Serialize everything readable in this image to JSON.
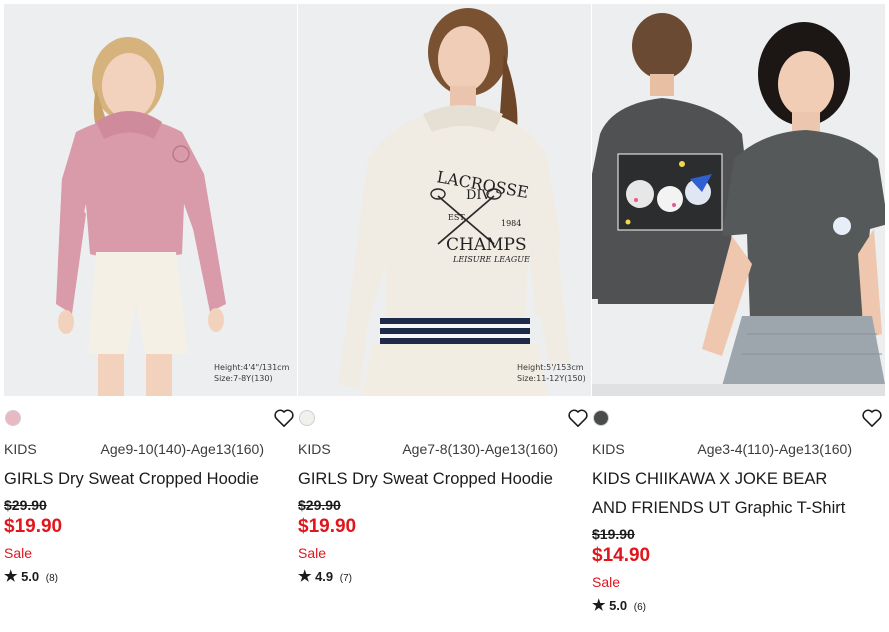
{
  "products": [
    {
      "swatch_color": "#eab8c3",
      "tag": "KIDS",
      "ages": "Age9-10(140)-Age13(160)",
      "title": "GIRLS Dry Sweat Cropped Hoodie",
      "old_price": "$29.90",
      "new_price": "$19.90",
      "sale": "Sale",
      "rating": "5.0",
      "review_count": "(8)",
      "height_note": "Height:4'4\"/131cm",
      "size_note": "Size:7-8Y(130)"
    },
    {
      "swatch_color": "#f2f0ec",
      "tag": "KIDS",
      "ages": "Age7-8(130)-Age13(160)",
      "title": "GIRLS Dry Sweat Cropped Hoodie",
      "old_price": "$29.90",
      "new_price": "$19.90",
      "sale": "Sale",
      "rating": "4.9",
      "review_count": "(7)",
      "height_note": "Height:5'/153cm",
      "size_note": "Size:11-12Y(150)",
      "print": {
        "line1": "LACROSSE",
        "line2": "DIV.",
        "est": "EST.",
        "year": "1984",
        "line3": "CHAMPS",
        "line4": "LEISURE LEAGUE"
      }
    },
    {
      "swatch_color": "#4a4b4c",
      "tag": "KIDS",
      "ages": "Age3-4(110)-Age13(160)",
      "title": "KIDS CHIIKAWA X JOKE BEAR AND FRIENDS UT Graphic T-Shirt",
      "old_price": "$19.90",
      "new_price": "$14.90",
      "sale": "Sale",
      "rating": "5.0",
      "review_count": "(6)"
    }
  ],
  "icons": {
    "favorite": "heart-outline-icon",
    "rating": "star-icon"
  },
  "colors": {
    "sale_red": "#e0161c",
    "text": "#1b1b1b"
  }
}
